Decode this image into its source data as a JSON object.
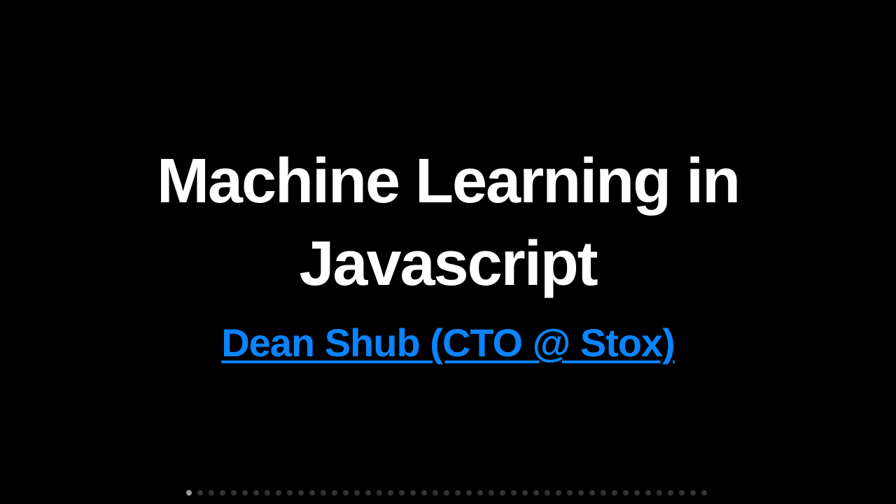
{
  "slide": {
    "title_line1": "Machine Learning in",
    "title_line2": "Javascript",
    "subtitle_link": "Dean Shub (CTO @ Stox)"
  },
  "progress": {
    "total_slides": 47,
    "current_slide": 1
  },
  "colors": {
    "background": "#000000",
    "title": "#ffffff",
    "link": "#0a84ff",
    "dot_active": "#9a9a9a",
    "dot_inactive": "#333333"
  }
}
